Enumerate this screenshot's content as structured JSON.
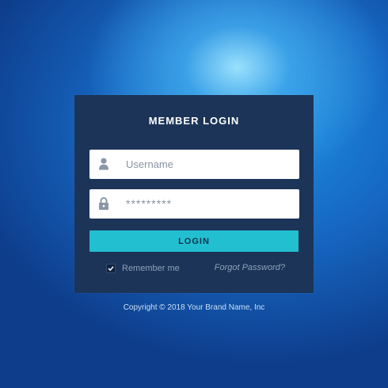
{
  "login": {
    "title": "MEMBER LOGIN",
    "username_placeholder": "Username",
    "password_masked": "*********",
    "login_button": "LOGIN",
    "remember_label": "Remember me",
    "remember_checked": true,
    "forgot_label": "Forgot Password?"
  },
  "footer": {
    "copyright": "Copyright © 2018 Your Brand Name, Inc"
  },
  "icons": {
    "username": "user-icon",
    "password": "lock-icon",
    "remember": "check-icon"
  },
  "colors": {
    "panel": "#1b3458",
    "button": "#22bfd0",
    "background": "#1667c2"
  }
}
